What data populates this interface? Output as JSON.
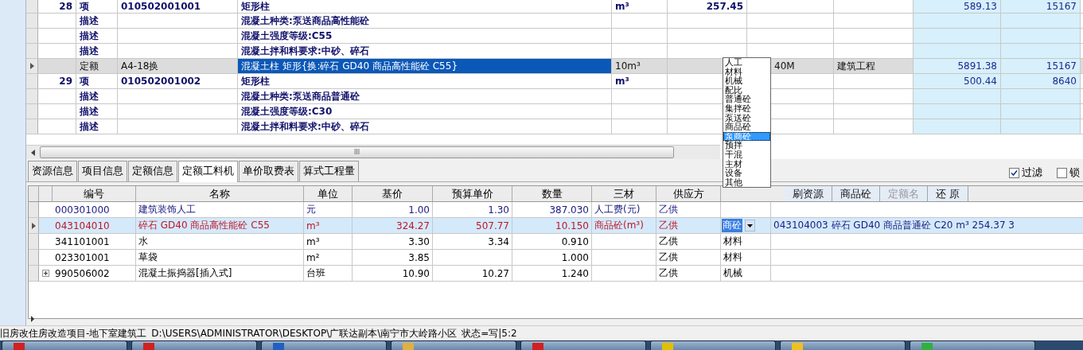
{
  "top_table": {
    "rows": [
      {
        "kind": "item",
        "selected": false,
        "cells": [
          "28",
          "项",
          "010502001001",
          "矩形柱",
          "m³",
          "257.45",
          "",
          "",
          "589.13",
          "15167"
        ]
      },
      {
        "kind": "desc",
        "selected": false,
        "cells": [
          "",
          "描述",
          "",
          "混凝土种类:泵送商品高性能砼",
          "",
          "",
          "",
          "",
          "",
          ""
        ]
      },
      {
        "kind": "desc",
        "selected": false,
        "cells": [
          "",
          "描述",
          "",
          "混凝土强度等级:C55",
          "",
          "",
          "",
          "",
          "",
          ""
        ]
      },
      {
        "kind": "desc",
        "selected": false,
        "cells": [
          "",
          "描述",
          "",
          "混凝土拌和料要求:中砂、碎石",
          "",
          "",
          "",
          "",
          "",
          ""
        ]
      },
      {
        "kind": "quota",
        "selected": true,
        "cells": [
          "",
          "定额",
          "A4-18换",
          "混凝土柱 矩形{换:碎石 GD40  商品高性能砼  C55}",
          "10m³",
          "",
          "40M",
          "建筑工程",
          "5891.38",
          "15167"
        ]
      },
      {
        "kind": "item",
        "selected": false,
        "cells": [
          "29",
          "项",
          "010502001002",
          "矩形柱",
          "m³",
          "",
          "",
          "",
          "500.44",
          "8640"
        ]
      },
      {
        "kind": "desc",
        "selected": false,
        "cells": [
          "",
          "描述",
          "",
          "混凝土种类:泵送商品普通砼",
          "",
          "",
          "",
          "",
          "",
          ""
        ]
      },
      {
        "kind": "desc",
        "selected": false,
        "cells": [
          "",
          "描述",
          "",
          "混凝土强度等级:C30",
          "",
          "",
          "",
          "",
          "",
          ""
        ]
      },
      {
        "kind": "desc",
        "selected": false,
        "cells": [
          "",
          "描述",
          "",
          "混凝土拌和料要求:中砂、碎石",
          "",
          "",
          "",
          "",
          "",
          ""
        ]
      }
    ]
  },
  "scrollbar_grip": "III",
  "tabs": [
    {
      "label": "资源信息",
      "selected": false
    },
    {
      "label": "项目信息",
      "selected": false
    },
    {
      "label": "定额信息",
      "selected": false
    },
    {
      "label": "定额工料机",
      "selected": true
    },
    {
      "label": "单价取费表",
      "selected": false
    },
    {
      "label": "算式工程量",
      "selected": false
    }
  ],
  "filters": [
    {
      "label": "过滤",
      "checked": true
    },
    {
      "label": "锁",
      "checked": false
    }
  ],
  "resource_table": {
    "columns": [
      "编号",
      "名称",
      "单位",
      "基价",
      "预算单价",
      "数量",
      "三材",
      "供应方"
    ],
    "toolbar": [
      {
        "label": "刷资源",
        "disabled": false
      },
      {
        "label": "商品砼",
        "disabled": false
      },
      {
        "label": "定额名",
        "disabled": true
      },
      {
        "label": "还 原",
        "disabled": false
      }
    ],
    "rows": [
      {
        "selected": false,
        "expandable": false,
        "color": "#1a1a80",
        "cells": [
          "000301000",
          "建筑装饰人工",
          "元",
          "1.00",
          "1.30",
          "387.030",
          "人工费(元)",
          "乙供"
        ],
        "category": "",
        "kind": "text"
      },
      {
        "selected": true,
        "expandable": false,
        "color": "#c0142a",
        "cells": [
          "043104010",
          "碎石 GD40  商品高性能砼  C55",
          "m³",
          "324.27",
          "507.77",
          "10.150",
          "商品砼(m³)",
          "乙供"
        ],
        "category": "商砼",
        "kind": "combo",
        "hint": "043104003  碎石 GD40  商品普通砼  C20  m³  254.37  3"
      },
      {
        "selected": false,
        "expandable": false,
        "color": "#000000",
        "cells": [
          "341101001",
          "水",
          "m³",
          "3.30",
          "3.34",
          "0.910",
          "",
          "乙供"
        ],
        "category": "材料",
        "kind": "text"
      },
      {
        "selected": false,
        "expandable": false,
        "color": "#000000",
        "cells": [
          "023301001",
          "草袋",
          "m²",
          "3.85",
          "",
          "1.000",
          "",
          "乙供"
        ],
        "category": "材料",
        "kind": "text"
      },
      {
        "selected": false,
        "expandable": true,
        "color": "#000000",
        "cells": [
          "990506002",
          "混凝土振捣器[插入式]",
          "台班",
          "10.90",
          "10.27",
          "1.240",
          "",
          "乙供"
        ],
        "category": "机械",
        "kind": "text"
      }
    ]
  },
  "dropdown": {
    "items": [
      {
        "label": "人工",
        "selected": false
      },
      {
        "label": "材料",
        "selected": false
      },
      {
        "label": "机械",
        "selected": false
      },
      {
        "label": "配比",
        "selected": false
      },
      {
        "label": "普通砼",
        "selected": false
      },
      {
        "label": "集拌砼",
        "selected": false
      },
      {
        "label": "泵送砼",
        "selected": false
      },
      {
        "label": "商品砼",
        "selected": false
      },
      {
        "label": "泵商砼",
        "selected": true
      },
      {
        "label": "预拌",
        "selected": false
      },
      {
        "label": "干混",
        "selected": false
      },
      {
        "label": "主材",
        "selected": false
      },
      {
        "label": "设备",
        "selected": false
      },
      {
        "label": "其他",
        "selected": false
      }
    ]
  },
  "status_bar": {
    "project": "旧房改住房改造项目-地下室建筑工",
    "path": "D:\\USERS\\ADMINISTRATOR\\DESKTOP\\广联达副本\\南宁市大岭路小区",
    "state": "状态=写|5:2"
  }
}
